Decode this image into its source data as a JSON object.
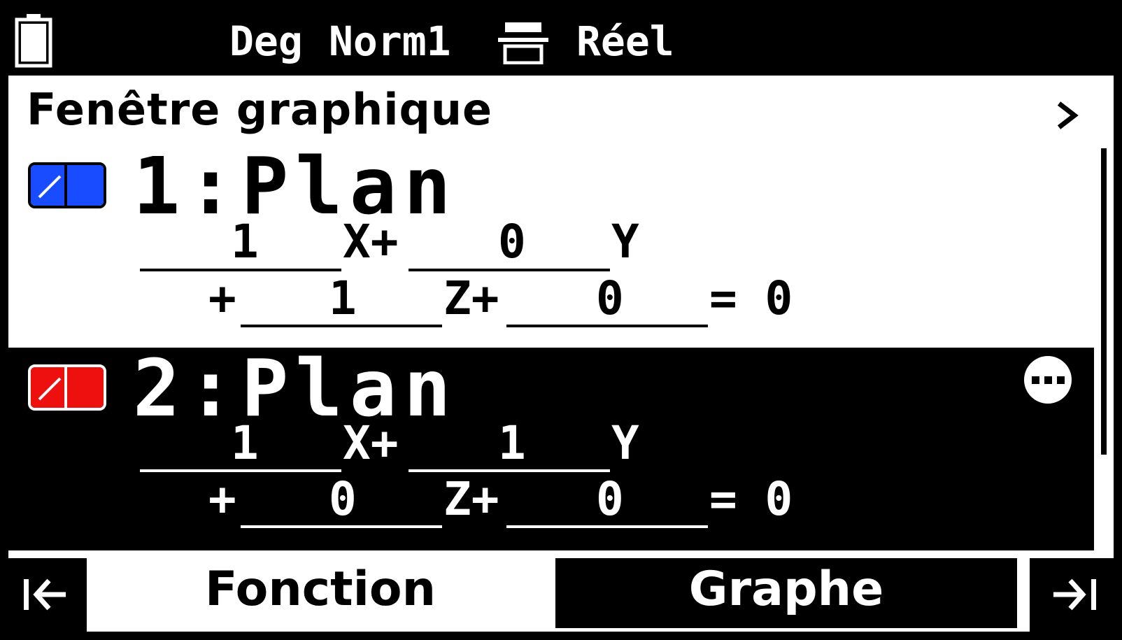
{
  "statusbar": {
    "angle": "Deg",
    "display": "Norm1",
    "complex": "Réel",
    "icons": [
      "battery-icon",
      "decimal-format-icon"
    ]
  },
  "header": {
    "title": "Fenêtre graphique",
    "chevron": "chevron-right-icon"
  },
  "rows": [
    {
      "title": "1:Plan",
      "color": "#1a4cff",
      "selected": false,
      "coefficients": {
        "x": "1",
        "y": "0",
        "z": "1",
        "const": "0"
      },
      "labels": {
        "x": "X+",
        "y": "Y",
        "plus": "+",
        "z": "Z+",
        "eq": "= 0"
      }
    },
    {
      "title": "2:Plan",
      "color": "#ee0f0f",
      "selected": true,
      "coefficients": {
        "x": "1",
        "y": "1",
        "z": "0",
        "const": "0"
      },
      "labels": {
        "x": "X+",
        "y": "Y",
        "plus": "+",
        "z": "Z+",
        "eq": "= 0"
      }
    }
  ],
  "tabs": {
    "fonction": "Fonction",
    "graphe": "Graphe",
    "left": "go-first-icon",
    "right": "go-last-icon"
  }
}
